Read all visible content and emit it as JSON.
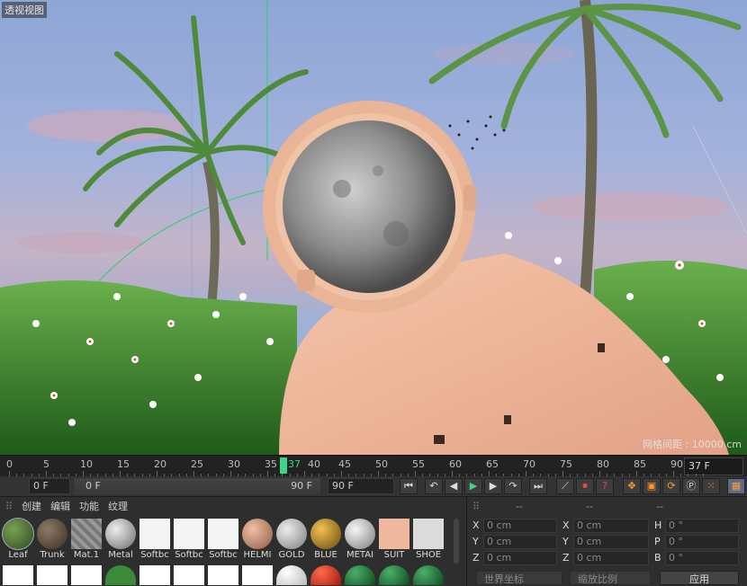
{
  "viewport": {
    "label": "透视视图",
    "hud_text": "网格间距 : 10000 cm"
  },
  "timeline": {
    "ticks": [
      "0",
      "5",
      "10",
      "15",
      "20",
      "25",
      "30",
      "35",
      "40",
      "45",
      "50",
      "55",
      "60",
      "65",
      "70",
      "75",
      "80",
      "85",
      "90"
    ],
    "current_frame_label": "37",
    "current_frame_field": "37 F"
  },
  "transport": {
    "start_field": "0 F",
    "range_start": "0 F",
    "range_end": "90 F",
    "end_field": "90 F"
  },
  "materials": {
    "menu": [
      "创建",
      "编辑",
      "功能",
      "纹理"
    ],
    "row1": [
      "Leaf",
      "Trunk",
      "Mat.1",
      "Metal",
      "Softbc",
      "Softbc",
      "Softbc",
      "HELMI",
      "GOLD",
      "BLUE",
      "METAI",
      "SUIT",
      "SHOE"
    ]
  },
  "coords": {
    "headers": [
      "--",
      "--",
      "--"
    ],
    "rows": [
      {
        "a": "X",
        "av": "0 cm",
        "b": "X",
        "bv": "0 cm",
        "c": "H",
        "cv": "0 °"
      },
      {
        "a": "Y",
        "av": "0 cm",
        "b": "Y",
        "bv": "0 cm",
        "c": "P",
        "cv": "0 °"
      },
      {
        "a": "Z",
        "av": "0 cm",
        "b": "Z",
        "bv": "0 cm",
        "c": "B",
        "cv": "0 °"
      }
    ],
    "world_coords": "世界坐标",
    "scale_ratio": "缩放比例",
    "apply": "应用"
  },
  "colors": {
    "accent": "#3ad58a",
    "sky_top": "#8ea6d6",
    "suit": "#f0b598",
    "grass": "#3a8a2a"
  }
}
